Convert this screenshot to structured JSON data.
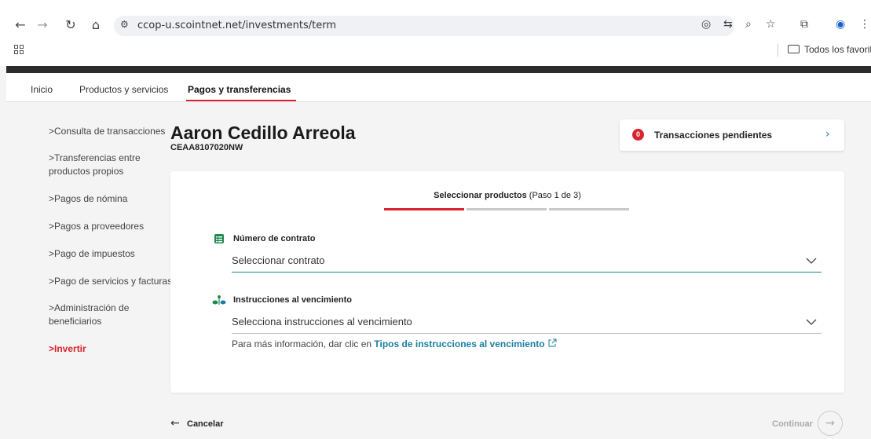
{
  "browser": {
    "url": "ccop-u.scointnet.net/investments/term",
    "bookmarks_label": "Todos los favoritos"
  },
  "site_nav": {
    "tabs": [
      {
        "label": "Inicio"
      },
      {
        "label": "Productos y servicios"
      },
      {
        "label": "Pagos y transferencias",
        "active": true
      }
    ]
  },
  "sidebar": {
    "items": [
      {
        "label": ">Consulta de transacciones"
      },
      {
        "label": ">Transferencias entre productos propios"
      },
      {
        "label": ">Pagos de nómina"
      },
      {
        "label": ">Pagos a proveedores"
      },
      {
        "label": ">Pago de impuestos"
      },
      {
        "label": ">Pago de servicios y facturas"
      },
      {
        "label": ">Administración de beneficiarios"
      },
      {
        "label": ">Invertir",
        "active": true
      }
    ]
  },
  "client": {
    "name": "Aaron Cedillo Arreola",
    "id": "CEAA8107020NW"
  },
  "pending": {
    "count": "0",
    "label": "Transacciones pendientes"
  },
  "wizard": {
    "step_title": "Seleccionar productos",
    "step_progress": "(Paso 1 de 3)",
    "current_step": 1,
    "total_steps": 3
  },
  "form": {
    "contract_label": "Número de contrato",
    "contract_placeholder": "Seleccionar contrato",
    "instructions_label": "Instrucciones al vencimiento",
    "instructions_placeholder": "Selecciona instrucciones al vencimiento",
    "help_prefix": "Para más información, dar clic en ",
    "help_link": "Tipos de instrucciones al vencimiento"
  },
  "footer": {
    "cancel_label": "Cancelar",
    "continue_label": "Continuar"
  },
  "colors": {
    "accent_red": "#d9232e",
    "link_teal": "#1a7fa0"
  }
}
